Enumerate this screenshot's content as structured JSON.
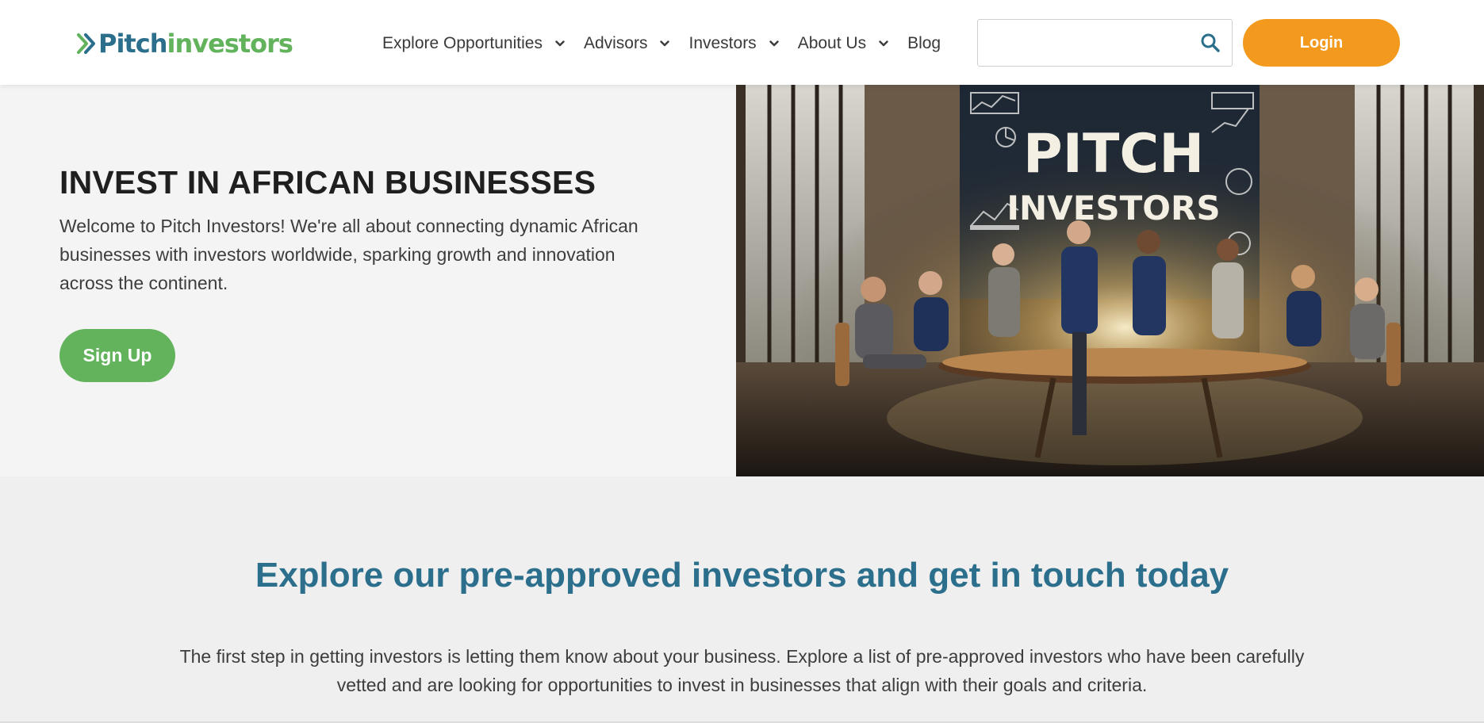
{
  "header": {
    "logo": {
      "part1": "Pitch",
      "part2": "investors"
    },
    "nav": [
      {
        "label": "Explore Opportunities",
        "has_dropdown": true,
        "icon": "chevron-down-icon"
      },
      {
        "label": "Advisors",
        "has_dropdown": true,
        "icon": "chevron-down-icon"
      },
      {
        "label": "Investors",
        "has_dropdown": true,
        "icon": "chevron-down-icon"
      },
      {
        "label": "About Us",
        "has_dropdown": true,
        "icon": "chevron-down-icon"
      },
      {
        "label": "Blog",
        "has_dropdown": false
      }
    ],
    "search": {
      "value": "",
      "placeholder": "",
      "icon": "search-icon"
    },
    "login_label": "Login"
  },
  "hero": {
    "title": "INVEST IN AFRICAN BUSINESSES",
    "description": "Welcome to Pitch Investors! We're all about connecting dynamic African businesses with investors worldwide, sparking growth and innovation across the continent.",
    "signup_label": "Sign Up",
    "image": {
      "sign_line1": "PITCH",
      "sign_line2": "INVESTORS"
    }
  },
  "explore": {
    "title": "Explore our pre-approved investors and get in touch today",
    "description": "The first step in getting investors is letting them know about your business. Explore a list of pre-approved investors who have been carefully vetted and are looking for opportunities to invest in businesses that align with their goals and criteria."
  },
  "colors": {
    "brand_blue": "#2b6f8d",
    "brand_green": "#62b35c",
    "login_orange": "#f39a1e",
    "hero_bg": "#f4f4f4",
    "section_bg": "#efefef"
  }
}
